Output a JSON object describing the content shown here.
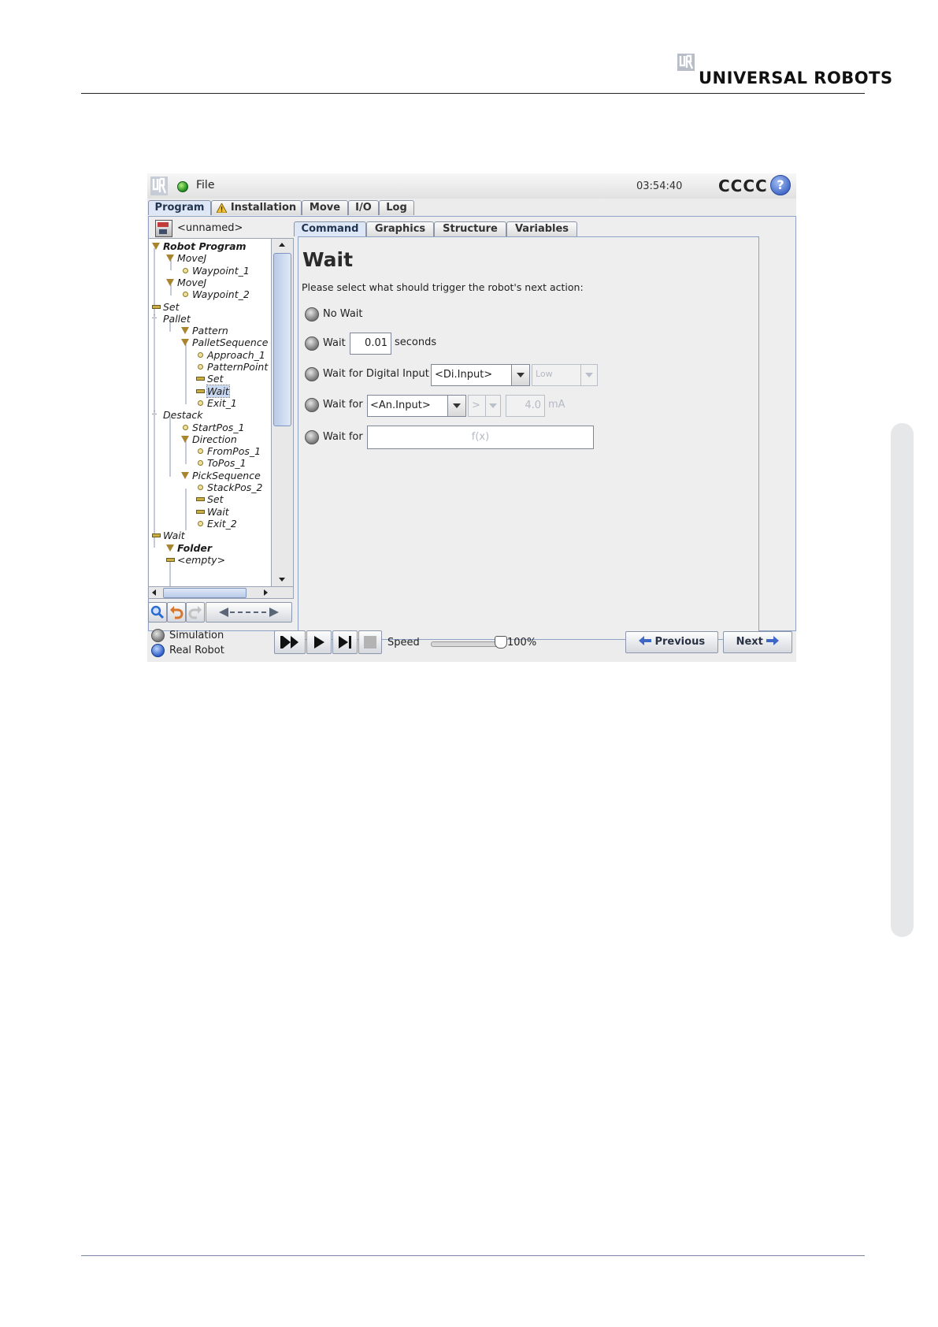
{
  "page": {
    "brand": "UNIVERSAL ROBOTS"
  },
  "app": {
    "menu_file": "File",
    "clock": "03:54:40",
    "robot_name": "CCCC",
    "help_glyph": "?",
    "main_tabs": [
      "Program",
      "Installation",
      "Move",
      "I/O",
      "Log"
    ],
    "program_name": "<unnamed>",
    "sub_tabs": [
      "Command",
      "Graphics",
      "Structure",
      "Variables"
    ],
    "tree": [
      {
        "label": "Robot Program",
        "icon": "triangle",
        "bold": true
      },
      {
        "label": "MoveJ",
        "icon": "triangle"
      },
      {
        "label": "Waypoint_1",
        "icon": "point"
      },
      {
        "label": "MoveJ",
        "icon": "triangle"
      },
      {
        "label": "Waypoint_2",
        "icon": "point"
      },
      {
        "label": "Set",
        "icon": "bar"
      },
      {
        "label": "Pallet",
        "icon": "pallet"
      },
      {
        "label": "Pattern",
        "icon": "triangle"
      },
      {
        "label": "PalletSequence",
        "icon": "triangle"
      },
      {
        "label": "Approach_1",
        "icon": "point"
      },
      {
        "label": "PatternPoint",
        "icon": "point"
      },
      {
        "label": "Set",
        "icon": "bar"
      },
      {
        "label": "Wait",
        "icon": "bar",
        "selected": true
      },
      {
        "label": "Exit_1",
        "icon": "point"
      },
      {
        "label": "Destack",
        "icon": "pallet"
      },
      {
        "label": "StartPos_1",
        "icon": "point"
      },
      {
        "label": "Direction",
        "icon": "triangle"
      },
      {
        "label": "FromPos_1",
        "icon": "point"
      },
      {
        "label": "ToPos_1",
        "icon": "point"
      },
      {
        "label": "PickSequence",
        "icon": "triangle"
      },
      {
        "label": "StackPos_2",
        "icon": "point"
      },
      {
        "label": "Set",
        "icon": "bar"
      },
      {
        "label": "Wait",
        "icon": "bar"
      },
      {
        "label": "Exit_2",
        "icon": "point"
      },
      {
        "label": "Wait",
        "icon": "bar"
      },
      {
        "label": "Folder",
        "icon": "triangle",
        "bold": true
      },
      {
        "label": "<empty>",
        "icon": "bar"
      }
    ],
    "command": {
      "title": "Wait",
      "prompt": "Please select what should trigger the robot's next action:",
      "opt_no_wait": "No Wait",
      "opt_wait": "Wait",
      "wait_value": "0.01",
      "seconds": "seconds",
      "opt_digital": "Wait for Digital Input",
      "digital_select": "<Di.Input>",
      "digital_level": "Low",
      "opt_analog": "Wait for",
      "analog_select": "<An.Input>",
      "analog_op": ">",
      "analog_value": "4.0",
      "analog_unit": "mA",
      "opt_expr": "Wait for",
      "expr_placeholder": "f(x)"
    },
    "footer": {
      "simulation": "Simulation",
      "real_robot": "Real Robot",
      "speed_label": "Speed",
      "speed_value": "100%",
      "previous": "Previous",
      "next": "Next"
    },
    "colors": {
      "accent": "#3f67c6",
      "status_green": "#1e8a1e",
      "tree_icon": "#a8852e"
    }
  }
}
